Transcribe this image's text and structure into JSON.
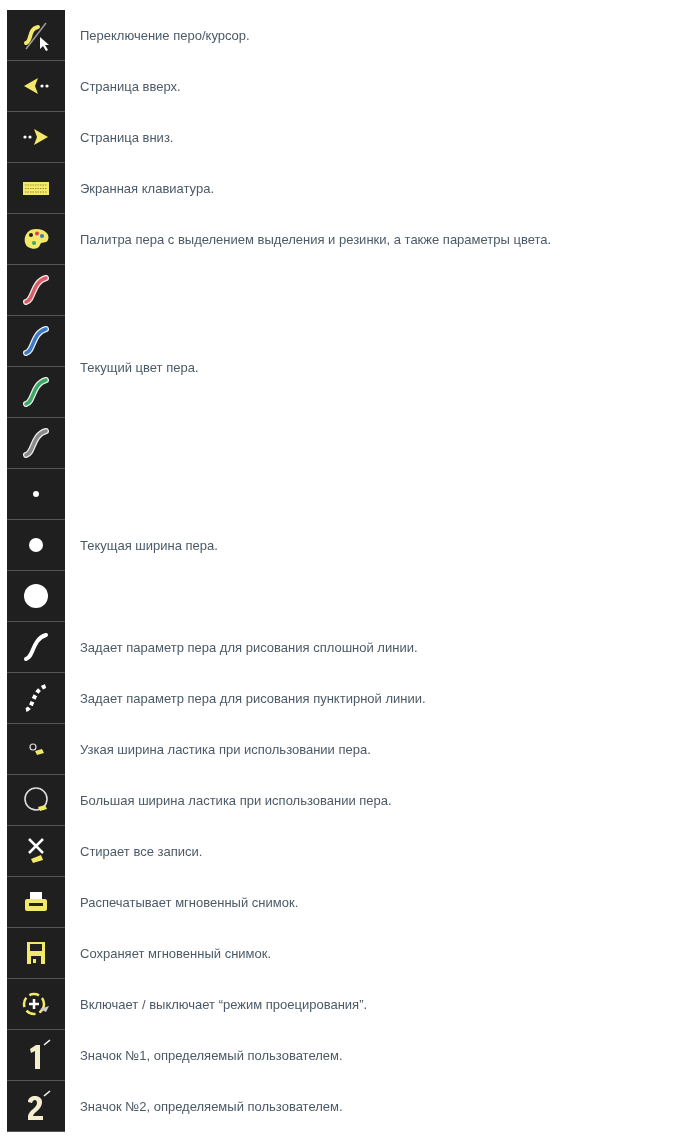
{
  "toolbar_groups": [
    {
      "icons": [
        {
          "kind": "pen-cursor"
        }
      ],
      "description": "Переключение перо/курсор."
    },
    {
      "icons": [
        {
          "kind": "page-up"
        }
      ],
      "description": "Страница вверх."
    },
    {
      "icons": [
        {
          "kind": "page-down"
        }
      ],
      "description": "Страница вниз."
    },
    {
      "icons": [
        {
          "kind": "keyboard"
        }
      ],
      "description": "Экранная клавиатура."
    },
    {
      "icons": [
        {
          "kind": "palette"
        }
      ],
      "description": "Палитра пера с выделением выделения и резинки, а также параметры цвета."
    },
    {
      "icons": [
        {
          "kind": "pen-color",
          "color": "#e05a64"
        },
        {
          "kind": "pen-color",
          "color": "#3a78c8"
        },
        {
          "kind": "pen-color",
          "color": "#3aa860"
        },
        {
          "kind": "pen-color",
          "color": "#8a8a8a"
        }
      ],
      "description": "Текущий цвет пера."
    },
    {
      "icons": [
        {
          "kind": "width-small"
        },
        {
          "kind": "width-medium"
        },
        {
          "kind": "width-large"
        }
      ],
      "description": "Текущая ширина пера."
    },
    {
      "icons": [
        {
          "kind": "solid-line"
        }
      ],
      "description": "Задает параметр пера для рисования сплошной линии."
    },
    {
      "icons": [
        {
          "kind": "dotted-line"
        }
      ],
      "description": "Задает параметр пера для рисования пунктирной линии."
    },
    {
      "icons": [
        {
          "kind": "eraser-small"
        }
      ],
      "description": "Узкая ширина ластика при использовании пера."
    },
    {
      "icons": [
        {
          "kind": "eraser-large"
        }
      ],
      "description": "Большая ширина ластика при использовании пера."
    },
    {
      "icons": [
        {
          "kind": "clear-all"
        }
      ],
      "description": "Стирает все записи."
    },
    {
      "icons": [
        {
          "kind": "print"
        }
      ],
      "description": "Распечатывает мгновенный снимок."
    },
    {
      "icons": [
        {
          "kind": "save"
        }
      ],
      "description": "Сохраняет мгновенный снимок."
    },
    {
      "icons": [
        {
          "kind": "projection"
        }
      ],
      "description": "Включает / выключает “режим проецирования”."
    },
    {
      "icons": [
        {
          "kind": "user-1"
        }
      ],
      "description": "Значок №1, определяемый пользователем."
    },
    {
      "icons": [
        {
          "kind": "user-2"
        }
      ],
      "description": "Значок №2, определяемый пользователем."
    }
  ]
}
